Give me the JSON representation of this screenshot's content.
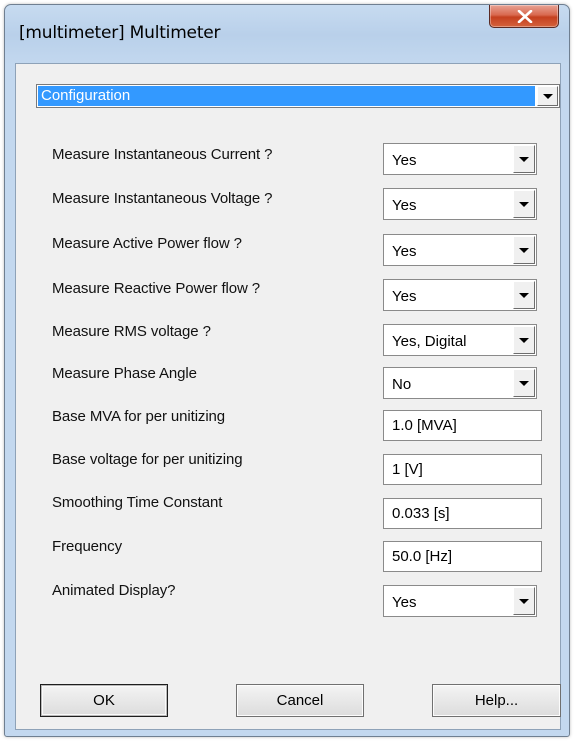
{
  "window": {
    "title": "[multimeter] Multimeter"
  },
  "icons": {
    "close": "close-icon",
    "dropdown": "chevron-down-icon"
  },
  "colors": {
    "selection": "#3399ff",
    "close_button": "#c9452a"
  },
  "category": {
    "value": "Configuration"
  },
  "fields": [
    {
      "label": "Measure Instantaneous Current ?",
      "value": "Yes"
    },
    {
      "label": "Measure Instantaneous Voltage ?",
      "value": "Yes"
    },
    {
      "label": "Measure Active Power flow ?",
      "value": "Yes"
    },
    {
      "label": "Measure Reactive Power flow ?",
      "value": "Yes"
    },
    {
      "label": "Measure RMS voltage ?",
      "value": "Yes, Digital"
    },
    {
      "label": "Measure Phase Angle",
      "value": "No"
    },
    {
      "label": "Base MVA for per unitizing",
      "value": "1.0 [MVA]"
    },
    {
      "label": "Base voltage for per unitizing",
      "value": "1 [V]"
    },
    {
      "label": "Smoothing Time Constant",
      "value": "0.033 [s]"
    },
    {
      "label": "Frequency",
      "value": "50.0 [Hz]"
    },
    {
      "label": "Animated Display?",
      "value": "Yes"
    }
  ],
  "buttons": {
    "ok": "OK",
    "cancel": "Cancel",
    "help": "Help..."
  }
}
